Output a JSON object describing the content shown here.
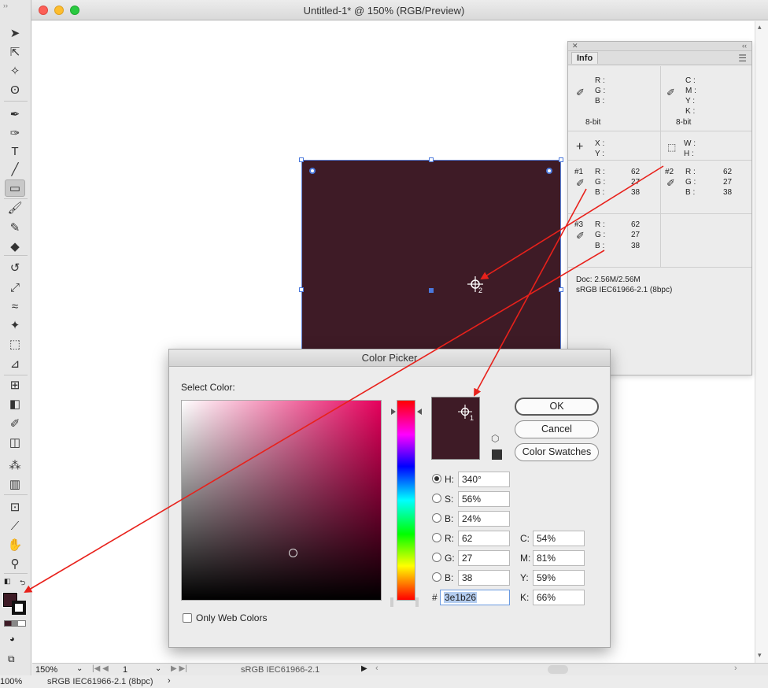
{
  "window": {
    "title": "Untitled-1* @ 150% (RGB/Preview)"
  },
  "tools": [
    {
      "name": "selection-tool",
      "icon": "➤"
    },
    {
      "name": "direct-selection-tool",
      "icon": "⇱"
    },
    {
      "name": "magic-wand-tool",
      "icon": "✧"
    },
    {
      "name": "lasso-tool",
      "icon": "ʘ"
    },
    {
      "name": "pen-tool",
      "icon": "✒"
    },
    {
      "name": "curvature-tool",
      "icon": "✑"
    },
    {
      "name": "type-tool",
      "icon": "T"
    },
    {
      "name": "line-tool",
      "icon": "╱"
    },
    {
      "name": "rectangle-tool",
      "icon": "▭"
    },
    {
      "name": "paintbrush-tool",
      "icon": "🖌"
    },
    {
      "name": "shaper-tool",
      "icon": "✎"
    },
    {
      "name": "eraser-tool",
      "icon": "◆"
    },
    {
      "name": "rotate-tool",
      "icon": "↺"
    },
    {
      "name": "scale-tool",
      "icon": "⤢"
    },
    {
      "name": "warp-tool",
      "icon": "≈"
    },
    {
      "name": "puppet-warp-tool",
      "icon": "✦"
    },
    {
      "name": "free-transform-tool",
      "icon": "⬚"
    },
    {
      "name": "perspective-grid-tool",
      "icon": "⊿"
    },
    {
      "name": "mesh-tool",
      "icon": "⊞"
    },
    {
      "name": "gradient-tool",
      "icon": "◧"
    },
    {
      "name": "eyedropper-tool",
      "icon": "✐"
    },
    {
      "name": "blend-tool",
      "icon": "◫"
    },
    {
      "name": "symbol-sprayer-tool",
      "icon": "⁂"
    },
    {
      "name": "column-graph-tool",
      "icon": "▥"
    },
    {
      "name": "artboard-tool",
      "icon": "⊡"
    },
    {
      "name": "slice-tool",
      "icon": "⟋"
    },
    {
      "name": "hand-tool",
      "icon": "✋"
    },
    {
      "name": "zoom-tool",
      "icon": "⚲"
    }
  ],
  "info_panel": {
    "tab": "Info",
    "labels": {
      "r": "R :",
      "g": "G :",
      "b": "B :",
      "c": "C :",
      "m": "M :",
      "y": "Y :",
      "k": "K :",
      "x": "X :",
      "y2": "Y :",
      "w": "W :",
      "h": "H :"
    },
    "bit_left": "8-bit",
    "bit_right": "8-bit",
    "sample1": {
      "id": "#1",
      "r": "62",
      "g": "27",
      "b": "38"
    },
    "sample2": {
      "id": "#2",
      "r": "62",
      "g": "27",
      "b": "38"
    },
    "sample3": {
      "id": "#3",
      "r": "62",
      "g": "27",
      "b": "38"
    },
    "doc_size": "Doc: 2.56M/2.56M",
    "profile": "sRGB IEC61966-2.1 (8bpc)"
  },
  "color_picker": {
    "title": "Color Picker",
    "select_label": "Select Color:",
    "ok": "OK",
    "cancel": "Cancel",
    "swatches": "Color Swatches",
    "sampler_index": "1",
    "hsb": [
      {
        "label": "H:",
        "value": "340°",
        "selected": true
      },
      {
        "label": "S:",
        "value": "56%",
        "selected": false
      },
      {
        "label": "B:",
        "value": "24%",
        "selected": false
      }
    ],
    "rgb": [
      {
        "label": "R:",
        "value": "62"
      },
      {
        "label": "G:",
        "value": "27"
      },
      {
        "label": "B:",
        "value": "38"
      }
    ],
    "cmyk": [
      {
        "label": "C:",
        "value": "54%"
      },
      {
        "label": "M:",
        "value": "81%"
      },
      {
        "label": "Y:",
        "value": "59%"
      },
      {
        "label": "K:",
        "value": "66%"
      }
    ],
    "hex_label": "#",
    "hex": "3e1b26",
    "web_only": "Only Web Colors",
    "current_color": "#3e1b26"
  },
  "canvas": {
    "sampler_index": "2"
  },
  "status": {
    "zoom": "150%",
    "page": "1",
    "profile": "sRGB IEC61966-2.1",
    "bottom_zoom": "100%",
    "bottom_profile": "sRGB IEC61966-2.1 (8bpc)"
  },
  "colors": {
    "art": "#3e1b26",
    "annotation": "#e8211b",
    "selection": "#4a78dc"
  }
}
